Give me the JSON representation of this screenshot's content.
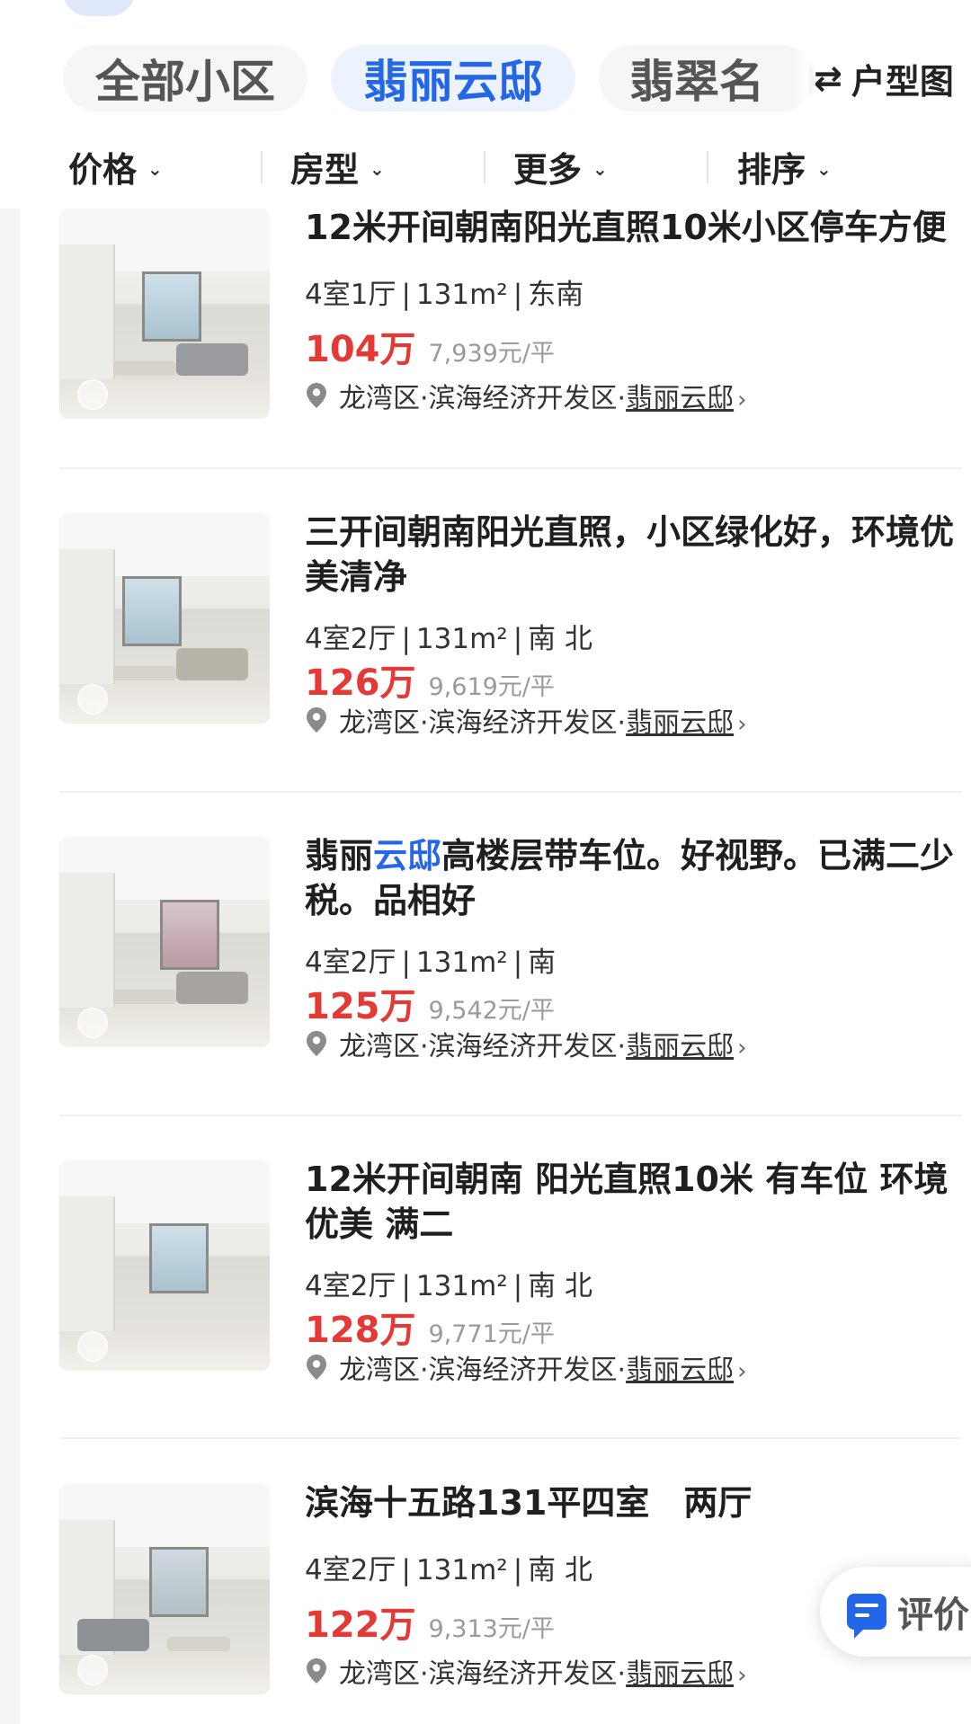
{
  "community_tabs": [
    {
      "label": "全部小区",
      "active": false
    },
    {
      "label": "翡丽云邸",
      "active": true
    },
    {
      "label": "翡翠名",
      "active": false
    }
  ],
  "layout_switch": {
    "icon": "swap-icon",
    "label": "户型图"
  },
  "filters": [
    {
      "label": "价格"
    },
    {
      "label": "房型"
    },
    {
      "label": "更多"
    },
    {
      "label": "排序"
    }
  ],
  "listings": [
    {
      "title": "12米开间朝南阳光直照10米小区停车方便",
      "layout": "4室1厅",
      "area": "131m²",
      "orientation": "东南",
      "price": "104万",
      "unit_price": "7,939元/平",
      "district": "龙湾区",
      "zone": "滨海经济开发区",
      "community": "翡丽云邸"
    },
    {
      "title": "三开间朝南阳光直照，小区绿化好，环境优美清净",
      "layout": "4室2厅",
      "area": "131m²",
      "orientation": "南 北",
      "price": "126万",
      "unit_price": "9,619元/平",
      "district": "龙湾区",
      "zone": "滨海经济开发区",
      "community": "翡丽云邸"
    },
    {
      "title_pre": "翡丽",
      "title_highlight": "云邸",
      "title_post": "高楼层带车位。好视野。已满二少税。品相好",
      "layout": "4室2厅",
      "area": "131m²",
      "orientation": "南",
      "price": "125万",
      "unit_price": "9,542元/平",
      "district": "龙湾区",
      "zone": "滨海经济开发区",
      "community": "翡丽云邸"
    },
    {
      "title": "12米开间朝南 阳光直照10米 有车位 环境优美 满二",
      "layout": "4室2厅",
      "area": "131m²",
      "orientation": "南 北",
      "price": "128万",
      "unit_price": "9,771元/平",
      "district": "龙湾区",
      "zone": "滨海经济开发区",
      "community": "翡丽云邸"
    },
    {
      "title": "滨海十五路131平四室　两厅",
      "layout": "4室2厅",
      "area": "131m²",
      "orientation": "南 北",
      "price": "122万",
      "unit_price": "9,313元/平",
      "district": "龙湾区",
      "zone": "滨海经济开发区",
      "community": "翡丽云邸"
    }
  ],
  "separators": {
    "dot": "·",
    "bar": "|",
    "chevron": "›",
    "caret": "⌄"
  },
  "review_button": {
    "label": "评价"
  },
  "colors": {
    "accent": "#2366e8",
    "price": "#e53935",
    "unit_price": "#9a9a9a"
  }
}
